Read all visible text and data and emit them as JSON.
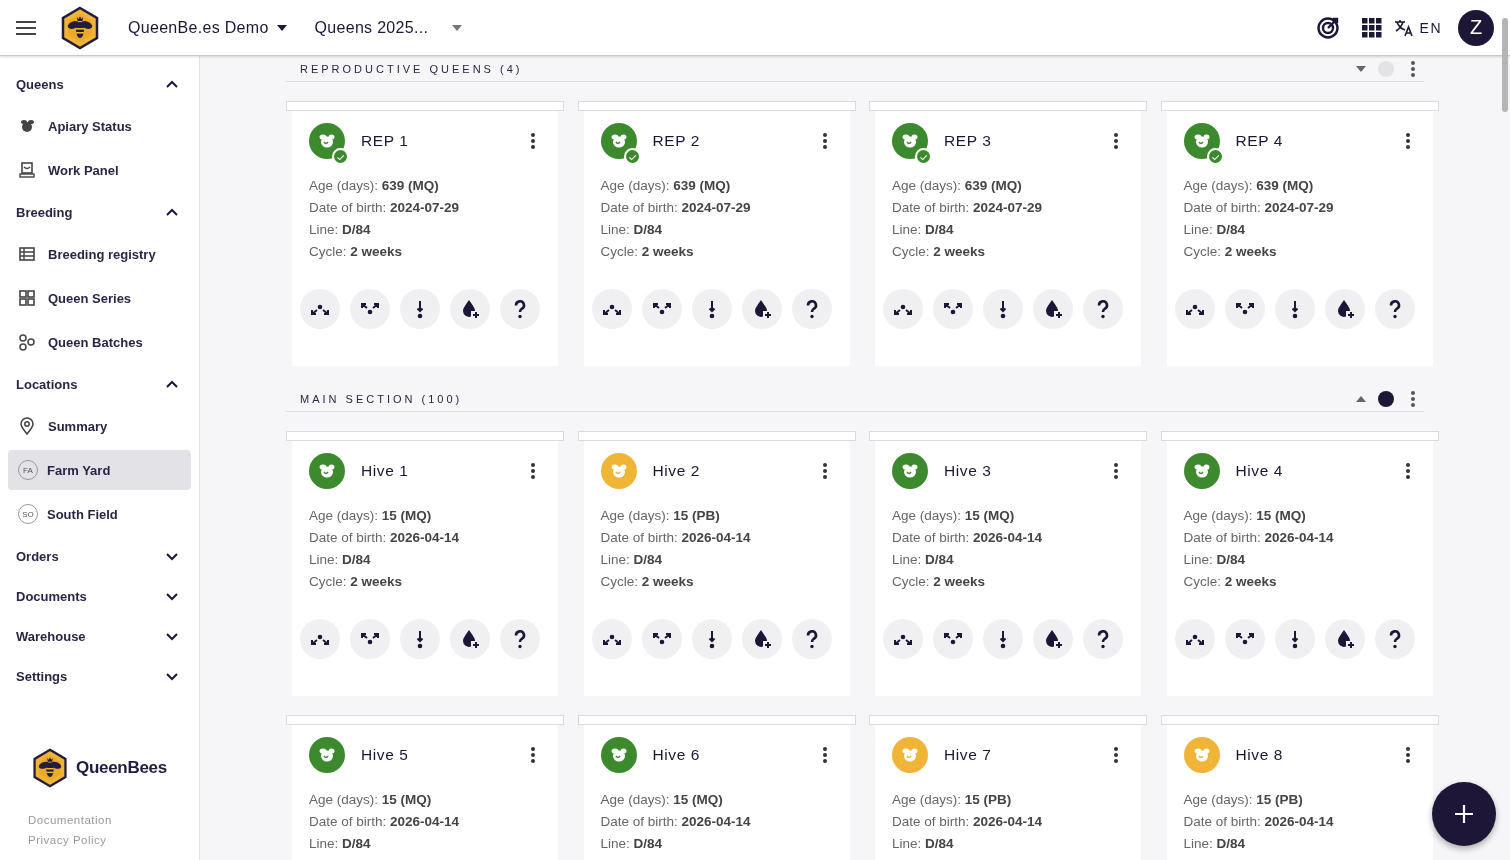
{
  "topbar": {
    "org": "QueenBe.es Demo",
    "season": "Queens 2025...",
    "language": "EN",
    "avatar": "Z"
  },
  "sidebar": {
    "items": [
      {
        "kind": "group",
        "label": "Queens",
        "expanded": true,
        "children": [
          {
            "kind": "link",
            "label": "Apiary Status",
            "selected": false
          },
          {
            "kind": "link",
            "label": "Work Panel",
            "selected": false
          }
        ]
      },
      {
        "kind": "group",
        "label": "Breeding",
        "expanded": true,
        "children": [
          {
            "kind": "link",
            "label": "Breeding registry",
            "selected": false
          },
          {
            "kind": "link",
            "label": "Queen Series",
            "selected": false
          },
          {
            "kind": "link",
            "label": "Queen Batches",
            "selected": false
          }
        ]
      },
      {
        "kind": "group",
        "label": "Locations",
        "expanded": true,
        "children": [
          {
            "kind": "link",
            "label": "Summary",
            "selected": false
          },
          {
            "kind": "location",
            "initials": "FA",
            "label": "Farm Yard",
            "selected": true
          },
          {
            "kind": "location",
            "initials": "SO",
            "label": "South Field",
            "selected": false
          }
        ]
      },
      {
        "kind": "group",
        "label": "Orders",
        "expanded": false
      },
      {
        "kind": "group",
        "label": "Documents",
        "expanded": false
      },
      {
        "kind": "group",
        "label": "Warehouse",
        "expanded": false
      },
      {
        "kind": "group",
        "label": "Settings",
        "expanded": false
      }
    ],
    "footer": {
      "brand": "QueenBees",
      "links": [
        "Documentation",
        "Privacy Policy"
      ]
    }
  },
  "sections": [
    {
      "title": "REPRODUCTIVE QUEENS (4)",
      "caret_up": false,
      "active": false,
      "cards": [
        {
          "name": "REP 1",
          "color": "#3d8a2e",
          "verified": true,
          "fields": [
            {
              "label": "Age (days):",
              "value": "639 (MQ)"
            },
            {
              "label": "Date of birth:",
              "value": "2024-07-29"
            },
            {
              "label": "Line:",
              "value": "D/84"
            },
            {
              "label": "Cycle:",
              "value": "2 weeks"
            }
          ]
        },
        {
          "name": "REP 2",
          "color": "#3d8a2e",
          "verified": true,
          "fields": [
            {
              "label": "Age (days):",
              "value": "639 (MQ)"
            },
            {
              "label": "Date of birth:",
              "value": "2024-07-29"
            },
            {
              "label": "Line:",
              "value": "D/84"
            },
            {
              "label": "Cycle:",
              "value": "2 weeks"
            }
          ]
        },
        {
          "name": "REP 3",
          "color": "#3d8a2e",
          "verified": true,
          "fields": [
            {
              "label": "Age (days):",
              "value": "639 (MQ)"
            },
            {
              "label": "Date of birth:",
              "value": "2024-07-29"
            },
            {
              "label": "Line:",
              "value": "D/84"
            },
            {
              "label": "Cycle:",
              "value": "2 weeks"
            }
          ]
        },
        {
          "name": "REP 4",
          "color": "#3d8a2e",
          "verified": true,
          "fields": [
            {
              "label": "Age (days):",
              "value": "639 (MQ)"
            },
            {
              "label": "Date of birth:",
              "value": "2024-07-29"
            },
            {
              "label": "Line:",
              "value": "D/84"
            },
            {
              "label": "Cycle:",
              "value": "2 weeks"
            }
          ]
        }
      ]
    },
    {
      "title": "MAIN SECTION (100)",
      "caret_up": true,
      "active": true,
      "cards": [
        {
          "name": "Hive 1",
          "color": "#3d8a2e",
          "verified": false,
          "fields": [
            {
              "label": "Age (days):",
              "value": "15 (MQ)"
            },
            {
              "label": "Date of birth:",
              "value": "2026-04-14"
            },
            {
              "label": "Line:",
              "value": "D/84"
            },
            {
              "label": "Cycle:",
              "value": "2 weeks"
            }
          ]
        },
        {
          "name": "Hive 2",
          "color": "#f0b437",
          "verified": false,
          "fields": [
            {
              "label": "Age (days):",
              "value": "15 (PB)"
            },
            {
              "label": "Date of birth:",
              "value": "2026-04-14"
            },
            {
              "label": "Line:",
              "value": "D/84"
            },
            {
              "label": "Cycle:",
              "value": "2 weeks"
            }
          ]
        },
        {
          "name": "Hive 3",
          "color": "#3d8a2e",
          "verified": false,
          "fields": [
            {
              "label": "Age (days):",
              "value": "15 (MQ)"
            },
            {
              "label": "Date of birth:",
              "value": "2026-04-14"
            },
            {
              "label": "Line:",
              "value": "D/84"
            },
            {
              "label": "Cycle:",
              "value": "2 weeks"
            }
          ]
        },
        {
          "name": "Hive 4",
          "color": "#3d8a2e",
          "verified": false,
          "fields": [
            {
              "label": "Age (days):",
              "value": "15 (MQ)"
            },
            {
              "label": "Date of birth:",
              "value": "2026-04-14"
            },
            {
              "label": "Line:",
              "value": "D/84"
            },
            {
              "label": "Cycle:",
              "value": "2 weeks"
            }
          ]
        },
        {
          "name": "Hive 5",
          "color": "#3d8a2e",
          "verified": false,
          "fields": [
            {
              "label": "Age (days):",
              "value": "15 (MQ)"
            },
            {
              "label": "Date of birth:",
              "value": "2026-04-14"
            },
            {
              "label": "Line:",
              "value": "D/84"
            }
          ]
        },
        {
          "name": "Hive 6",
          "color": "#3d8a2e",
          "verified": false,
          "fields": [
            {
              "label": "Age (days):",
              "value": "15 (MQ)"
            },
            {
              "label": "Date of birth:",
              "value": "2026-04-14"
            },
            {
              "label": "Line:",
              "value": "D/84"
            }
          ]
        },
        {
          "name": "Hive 7",
          "color": "#f0b437",
          "verified": false,
          "fields": [
            {
              "label": "Age (days):",
              "value": "15 (PB)"
            },
            {
              "label": "Date of birth:",
              "value": "2026-04-14"
            },
            {
              "label": "Line:",
              "value": "D/84"
            }
          ]
        },
        {
          "name": "Hive 8",
          "color": "#f0b437",
          "verified": false,
          "fields": [
            {
              "label": "Age (days):",
              "value": "15 (PB)"
            },
            {
              "label": "Date of birth:",
              "value": "2026-04-14"
            },
            {
              "label": "Line:",
              "value": "D/84"
            }
          ]
        }
      ]
    }
  ]
}
